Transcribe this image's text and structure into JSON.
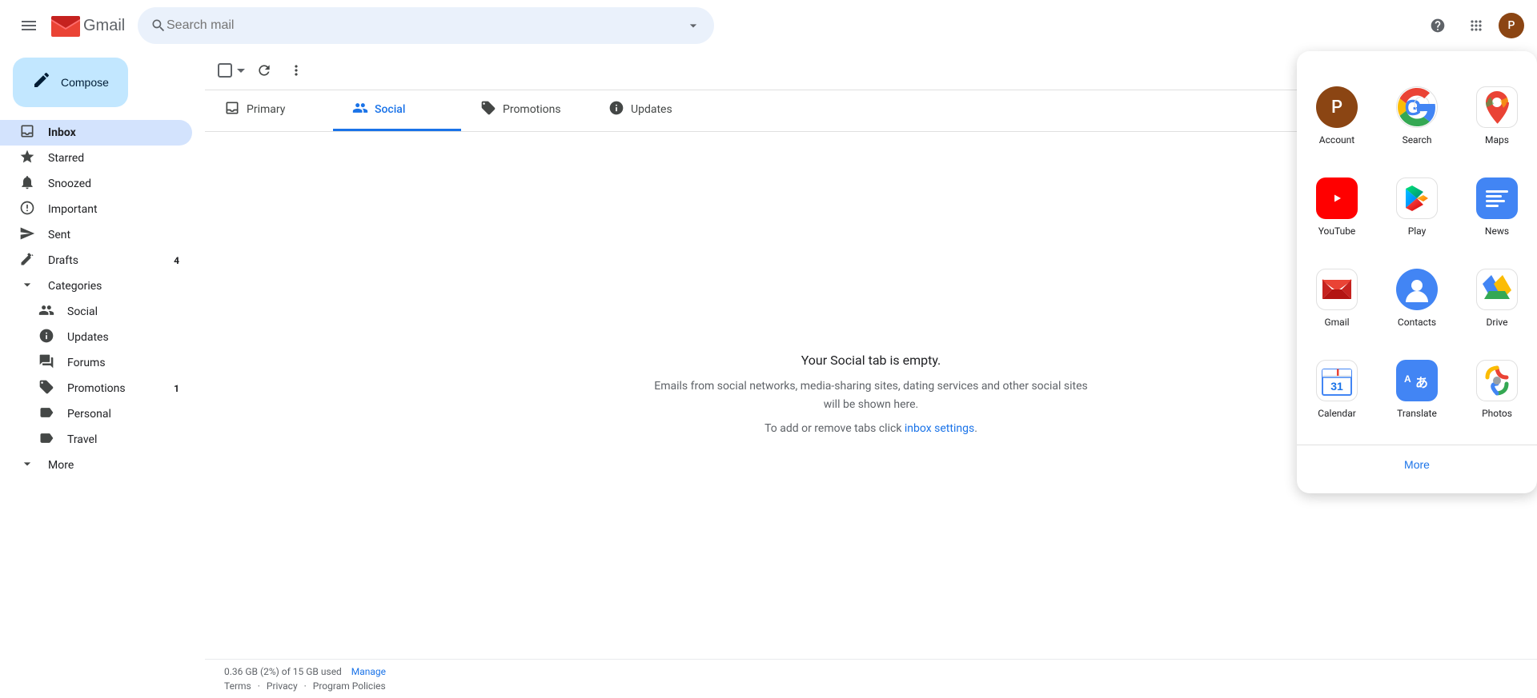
{
  "topbar": {
    "gmail_text": "Gmail",
    "search_placeholder": "Search mail",
    "support_label": "Support",
    "apps_label": "Google apps"
  },
  "sidebar": {
    "compose_label": "Compose",
    "nav_items": [
      {
        "id": "inbox",
        "label": "Inbox",
        "icon": "inbox",
        "active": true,
        "count": ""
      },
      {
        "id": "starred",
        "label": "Starred",
        "icon": "star",
        "active": false,
        "count": ""
      },
      {
        "id": "snoozed",
        "label": "Snoozed",
        "icon": "clock",
        "active": false,
        "count": ""
      },
      {
        "id": "important",
        "label": "Important",
        "icon": "label",
        "active": false,
        "count": ""
      },
      {
        "id": "sent",
        "label": "Sent",
        "icon": "send",
        "active": false,
        "count": ""
      },
      {
        "id": "drafts",
        "label": "Drafts",
        "icon": "drafts",
        "active": false,
        "count": "4"
      }
    ],
    "categories_label": "Categories",
    "sub_items": [
      {
        "id": "social",
        "label": "Social",
        "icon": "people"
      },
      {
        "id": "updates",
        "label": "Updates",
        "icon": "info"
      },
      {
        "id": "forums",
        "label": "Forums",
        "icon": "forum"
      },
      {
        "id": "promotions",
        "label": "Promotions",
        "icon": "tag",
        "count": "1"
      }
    ],
    "more_items": [
      {
        "id": "personal",
        "label": "Personal",
        "icon": "label"
      },
      {
        "id": "travel",
        "label": "Travel",
        "icon": "label"
      }
    ],
    "more_label": "More"
  },
  "toolbar": {
    "refresh_title": "Refresh",
    "more_title": "More"
  },
  "tabs": [
    {
      "id": "primary",
      "label": "Primary",
      "icon": "inbox",
      "active": false
    },
    {
      "id": "social",
      "label": "Social",
      "icon": "people",
      "active": true
    },
    {
      "id": "promotions",
      "label": "Promotions",
      "icon": "tag",
      "active": false
    },
    {
      "id": "updates",
      "label": "Updates",
      "icon": "info",
      "active": false
    }
  ],
  "empty_state": {
    "title": "Your Social tab is empty.",
    "line1": "Emails from social networks, media-sharing sites, dating services and other social sites",
    "line2": "will be shown here.",
    "line3_before": "To add or remove tabs click ",
    "link_text": "inbox settings",
    "line3_after": "."
  },
  "footer": {
    "storage": "0.36 GB (2%) of 15 GB used",
    "manage": "Manage",
    "terms": "Terms",
    "privacy": "Privacy",
    "program_policies": "Program Policies",
    "sep1": "·",
    "sep2": "·"
  },
  "apps_panel": {
    "apps": [
      {
        "id": "account",
        "label": "Account",
        "type": "account"
      },
      {
        "id": "search",
        "label": "Search",
        "type": "search"
      },
      {
        "id": "maps",
        "label": "Maps",
        "type": "maps"
      },
      {
        "id": "youtube",
        "label": "YouTube",
        "type": "youtube"
      },
      {
        "id": "play",
        "label": "Play",
        "type": "play"
      },
      {
        "id": "news",
        "label": "News",
        "type": "news"
      },
      {
        "id": "gmail",
        "label": "Gmail",
        "type": "gmail"
      },
      {
        "id": "contacts",
        "label": "Contacts",
        "type": "contacts"
      },
      {
        "id": "drive",
        "label": "Drive",
        "type": "drive"
      },
      {
        "id": "calendar",
        "label": "Calendar",
        "type": "calendar"
      },
      {
        "id": "translate",
        "label": "Translate",
        "type": "translate"
      },
      {
        "id": "photos",
        "label": "Photos",
        "type": "photos"
      }
    ],
    "more_label": "More"
  }
}
